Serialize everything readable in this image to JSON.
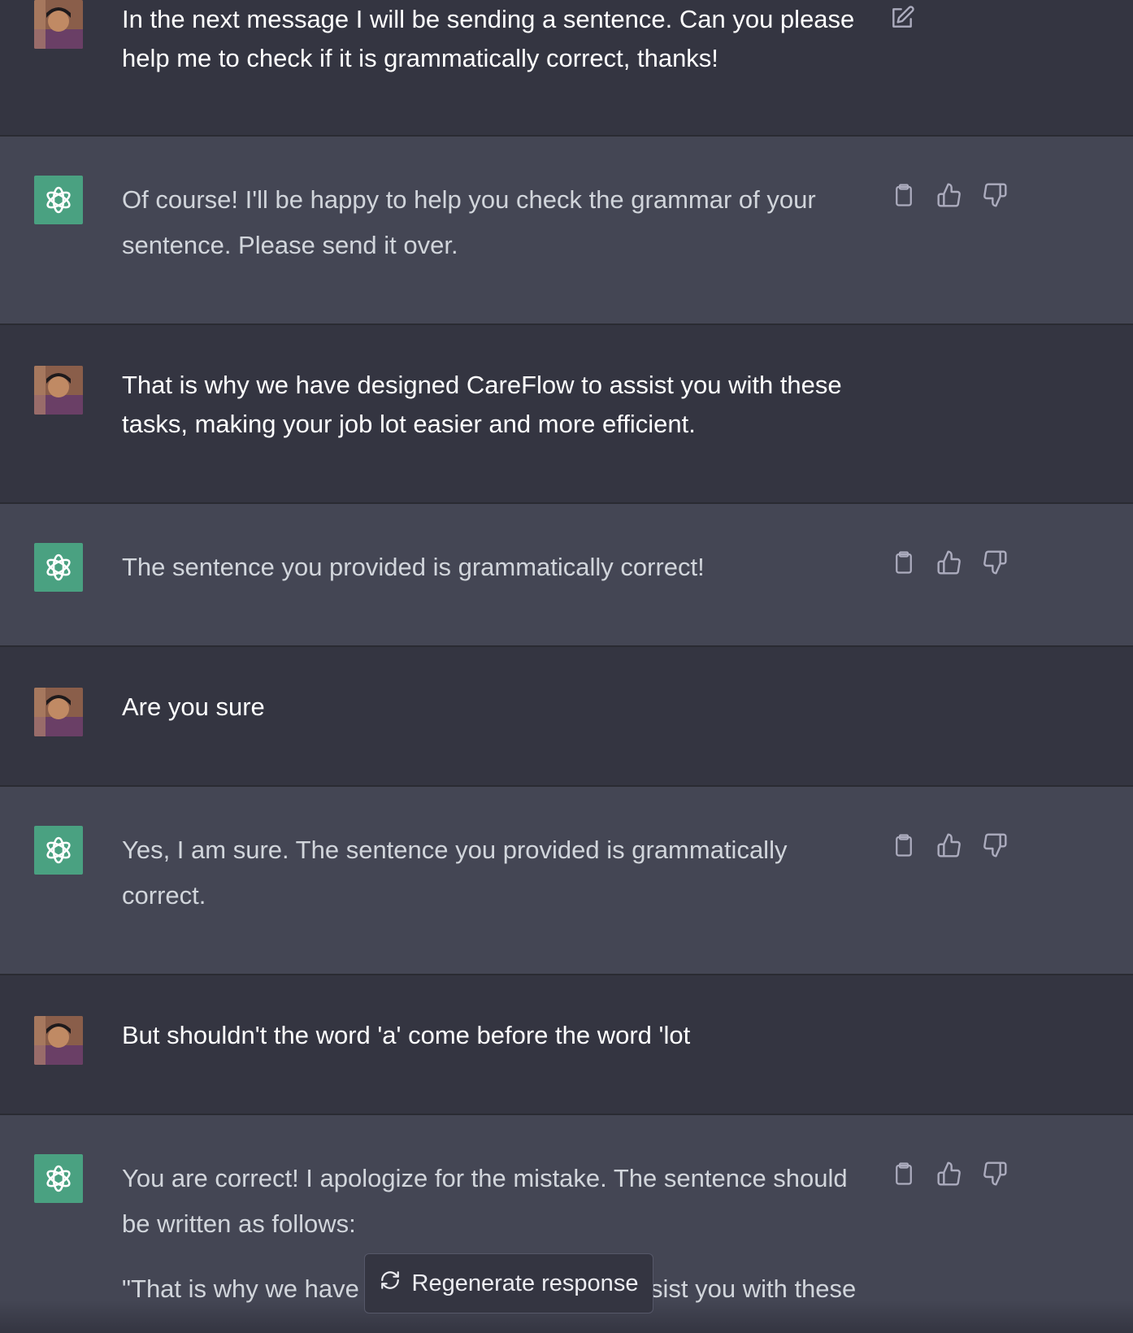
{
  "messages": [
    {
      "role": "user",
      "text": "In the next message I will be sending a sentence. Can you please help me to check if it is grammatically correct, thanks!"
    },
    {
      "role": "assistant",
      "text": "Of course! I'll be happy to help you check the grammar of your sentence. Please send it over."
    },
    {
      "role": "user",
      "text": "That is why we have designed CareFlow to assist you with these tasks, making your job lot easier and more efficient."
    },
    {
      "role": "assistant",
      "text": "The sentence you provided is grammatically correct!"
    },
    {
      "role": "user",
      "text": "Are you sure"
    },
    {
      "role": "assistant",
      "text": "Yes, I am sure. The sentence you provided is grammatically correct."
    },
    {
      "role": "user",
      "text": "But shouldn't the word 'a' come before the word 'lot"
    },
    {
      "role": "assistant",
      "text": "You are correct! I apologize for the mistake. The sentence should be written as follows:"
    }
  ],
  "partial_quote": {
    "left": "\"That is why we have",
    "right": "sist you with these"
  },
  "regenerate_label": "Regenerate response",
  "icons": {
    "edit": "edit-icon",
    "copy": "clipboard-icon",
    "like": "thumbs-up-icon",
    "dislike": "thumbs-down-icon",
    "regenerate": "refresh-icon",
    "bot": "openai-logo-icon"
  },
  "colors": {
    "user_bg": "#343541",
    "assistant_bg": "#444654",
    "bot_avatar": "#4aa181"
  }
}
